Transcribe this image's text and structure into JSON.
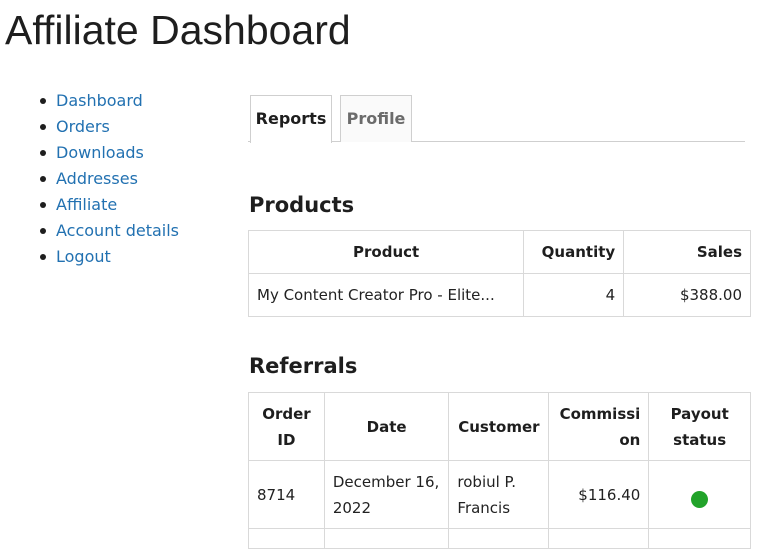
{
  "page": {
    "title": "Affiliate Dashboard"
  },
  "nav": {
    "items": [
      {
        "label": "Dashboard"
      },
      {
        "label": "Orders"
      },
      {
        "label": "Downloads"
      },
      {
        "label": "Addresses"
      },
      {
        "label": "Affiliate"
      },
      {
        "label": "Account details"
      },
      {
        "label": "Logout"
      }
    ]
  },
  "tabs": [
    {
      "label": "Reports",
      "active": true
    },
    {
      "label": "Profile",
      "active": false
    }
  ],
  "products": {
    "title": "Products",
    "columns": {
      "product": "Product",
      "quantity": "Quantity",
      "sales": "Sales"
    },
    "rows": [
      {
        "product": "My Content Creator Pro - Elite...",
        "quantity": "4",
        "sales": "$388.00"
      }
    ]
  },
  "referrals": {
    "title": "Referrals",
    "columns": {
      "order_id_1": "Order",
      "order_id_2": "ID",
      "date": "Date",
      "customer": "Customer",
      "commission_1": "Commissi",
      "commission_2": "on",
      "payout_1": "Payout",
      "payout_2": "status"
    },
    "rows": [
      {
        "order_id": "8714",
        "date_1": "December 16,",
        "date_2": "2022",
        "customer_1": "robiul P.",
        "customer_2": "Francis",
        "commission": "$116.40",
        "payout_status": "paid",
        "payout_color": "#22a32a"
      }
    ]
  }
}
